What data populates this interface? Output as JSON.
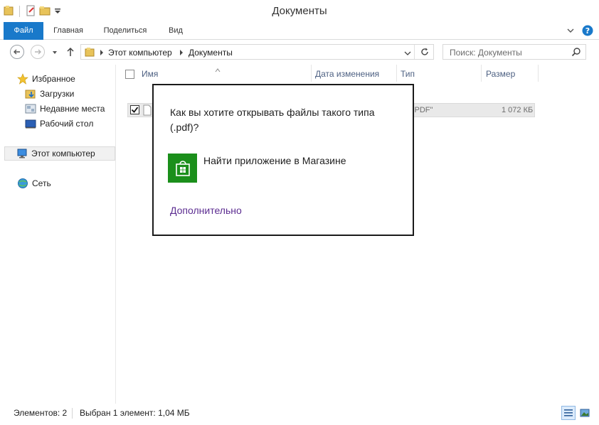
{
  "window": {
    "title": "Документы"
  },
  "ribbon": {
    "tabs": [
      {
        "label": "Файл"
      },
      {
        "label": "Главная"
      },
      {
        "label": "Поделиться"
      },
      {
        "label": "Вид"
      }
    ]
  },
  "address": {
    "crumbs": [
      "Этот компьютер",
      "Документы"
    ],
    "search_placeholder": "Поиск: Документы"
  },
  "navpane": {
    "favorites": "Избранное",
    "downloads": "Загрузки",
    "recent": "Недавние места",
    "desktop": "Рабочий стол",
    "computer": "Этот компьютер",
    "network": "Сеть"
  },
  "columns": {
    "name": "Имя",
    "date": "Дата изменения",
    "type": "Тип",
    "size": "Размер"
  },
  "file_row": {
    "type": "йл \"PDF\"",
    "size": "1 072 КБ"
  },
  "dialog": {
    "question": "Как вы хотите открывать файлы такого типа (.pdf)?",
    "store_option": "Найти приложение в Магазине",
    "more_link": "Дополнительно"
  },
  "status": {
    "count": "Элементов: 2",
    "selection": "Выбран 1 элемент: 1,04 МБ"
  },
  "colors": {
    "file_tab": "#1979ca",
    "store_tile": "#1b8f1b",
    "link": "#5c2d91"
  }
}
